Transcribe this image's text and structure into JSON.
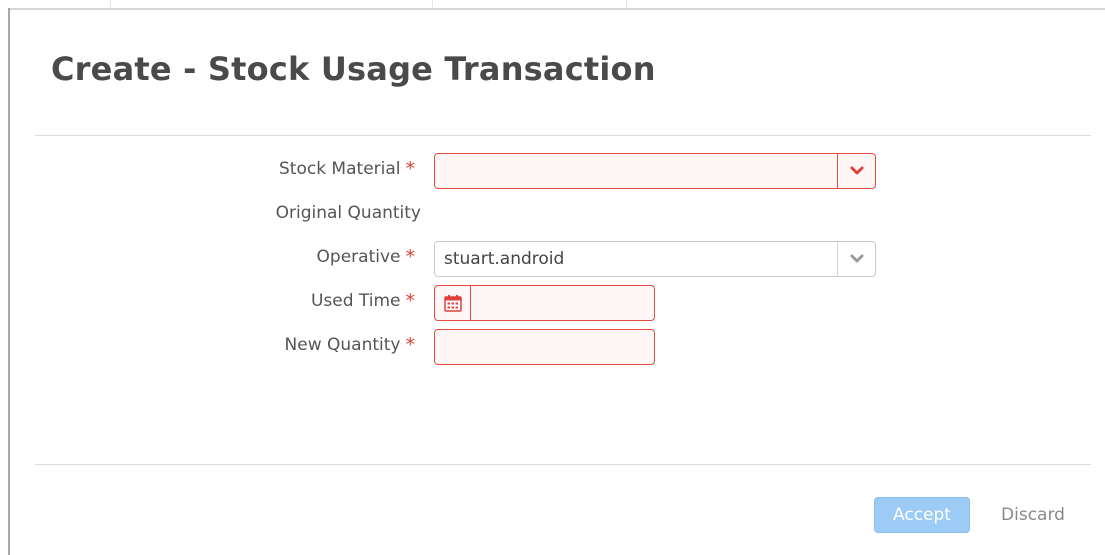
{
  "dialog": {
    "title": "Create - Stock Usage Transaction"
  },
  "form": {
    "stock_material": {
      "label": "Stock Material",
      "required_mark": "*",
      "value": "",
      "state": "error",
      "dropdown_icon": "chevron-down-icon"
    },
    "original_quantity": {
      "label": "Original Quantity",
      "value": ""
    },
    "operative": {
      "label": "Operative",
      "required_mark": "*",
      "value": "stuart.android",
      "dropdown_icon": "chevron-down-icon"
    },
    "used_time": {
      "label": "Used Time",
      "required_mark": "*",
      "value": "",
      "state": "error",
      "calendar_icon": "calendar-icon"
    },
    "new_quantity": {
      "label": "New Quantity",
      "required_mark": "*",
      "value": "",
      "state": "error"
    }
  },
  "footer": {
    "accept_label": "Accept",
    "discard_label": "Discard"
  },
  "colors": {
    "error_border": "#e84a3d",
    "required_star": "#e0413a",
    "accept_button": "#9ccbf5",
    "title_text": "#4a4a4a"
  }
}
